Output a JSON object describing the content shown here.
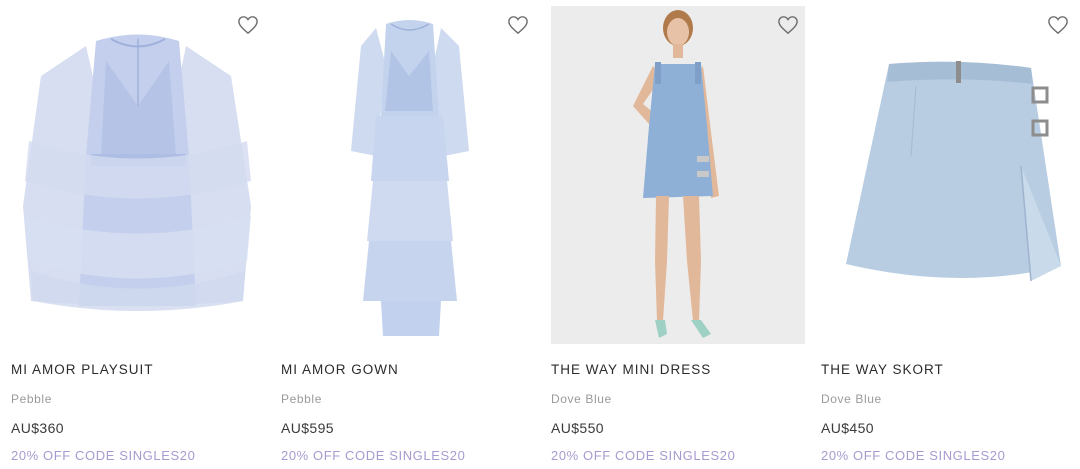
{
  "products": [
    {
      "name": "MI AMOR PLAYSUIT",
      "color": "Pebble",
      "price": "AU$360",
      "promo": "20% OFF CODE SINGLES20",
      "image_icon": "playsuit-image"
    },
    {
      "name": "MI AMOR GOWN",
      "color": "Pebble",
      "price": "AU$595",
      "promo": "20% OFF CODE SINGLES20",
      "image_icon": "gown-image"
    },
    {
      "name": "THE WAY MINI DRESS",
      "color": "Dove Blue",
      "price": "AU$550",
      "promo": "20% OFF CODE SINGLES20",
      "image_icon": "mini-dress-model-image"
    },
    {
      "name": "THE WAY SKORT",
      "color": "Dove Blue",
      "price": "AU$450",
      "promo": "20% OFF CODE SINGLES20",
      "image_icon": "skort-image"
    }
  ],
  "colors": {
    "text_primary": "#2b2b2b",
    "text_muted": "#9a9a9a",
    "promo": "#a89ad0",
    "garment_blue": "#b9c9e2"
  },
  "icons": {
    "wishlist": "heart-outline-icon"
  }
}
